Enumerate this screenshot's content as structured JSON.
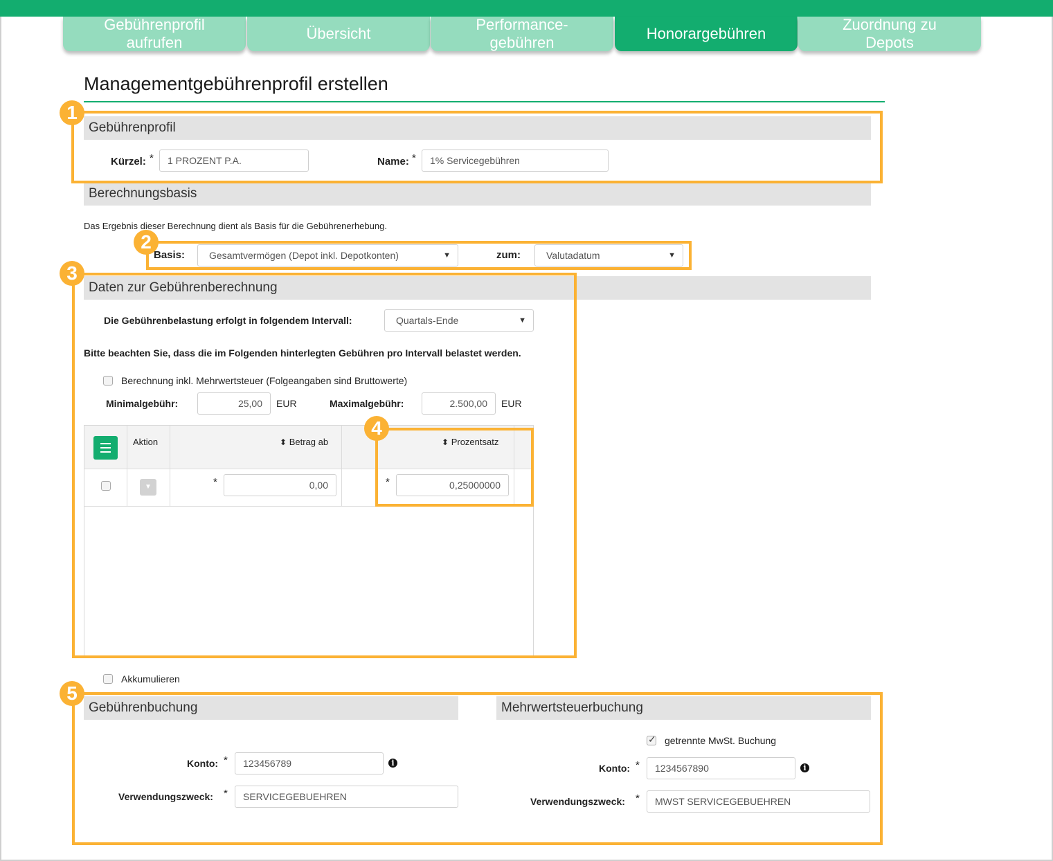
{
  "tabs": [
    {
      "label": "Gebührenprofil\naufrufen",
      "active": false
    },
    {
      "label": "Übersicht",
      "active": false
    },
    {
      "label": "Performance-\ngebühren",
      "active": false
    },
    {
      "label": "Honorargebühren",
      "active": true
    },
    {
      "label": "Zuordnung zu\nDepots",
      "active": false
    }
  ],
  "page_title": "Managementgebührenprofil erstellen",
  "badges": [
    "1",
    "2",
    "3",
    "4",
    "5"
  ],
  "profile": {
    "header": "Gebührenprofil",
    "kuerzel_label": "Kürzel:",
    "kuerzel_value": "1 PROZENT P.A.",
    "name_label": "Name:",
    "name_value": "1% Servicegebühren",
    "required_mark": "*"
  },
  "basis": {
    "header": "Berechnungsbasis",
    "description": "Das Ergebnis dieser Berechnung dient als Basis für die Gebührenerhebung.",
    "basis_label": "Basis:",
    "basis_value": "Gesamtvermögen (Depot inkl. Depotkonten)",
    "zum_label": "zum:",
    "zum_value": "Valutadatum"
  },
  "calc": {
    "header": "Daten zur Gebührenberechnung",
    "interval_label": "Die Gebührenbelastung erfolgt in folgendem Intervall:",
    "interval_value": "Quartals-Ende",
    "note": "Bitte beachten Sie, dass die im Folgenden hinterlegten Gebühren pro Intervall belastet werden.",
    "vat_checkbox_label": "Berechnung inkl. Mehrwertsteuer (Folgeangaben sind Bruttowerte)",
    "min_label": "Minimalgebühr:",
    "min_value": "25,00",
    "max_label": "Maximalgebühr:",
    "max_value": "2.500,00",
    "currency": "EUR"
  },
  "grid": {
    "col_action": "Aktion",
    "col_amount": "Betrag ab",
    "col_percent": "Prozentsatz",
    "sort_icon": "⬍",
    "rows": [
      {
        "amount": "0,00",
        "percent": "0,25000000"
      }
    ]
  },
  "accumulate_label": "Akkumulieren",
  "booking": {
    "header": "Gebührenbuchung",
    "konto_label": "Konto:",
    "konto_value": "123456789",
    "purpose_label": "Verwendungszweck:",
    "purpose_value": "SERVICEGEBUEHREN"
  },
  "vat_booking": {
    "header": "Mehrwertsteuerbuchung",
    "separate_label": "getrennte MwSt. Buchung",
    "separate_checked": true,
    "konto_label": "Konto:",
    "konto_value": "1234567890",
    "purpose_label": "Verwendungszweck:",
    "purpose_value": "MWST SERVICEGEBUEHREN"
  },
  "colors": {
    "brand_green": "#13ad6f",
    "tab_inactive": "#95dcbe",
    "highlight": "#fbb234",
    "section_bg": "#e3e3e3"
  }
}
